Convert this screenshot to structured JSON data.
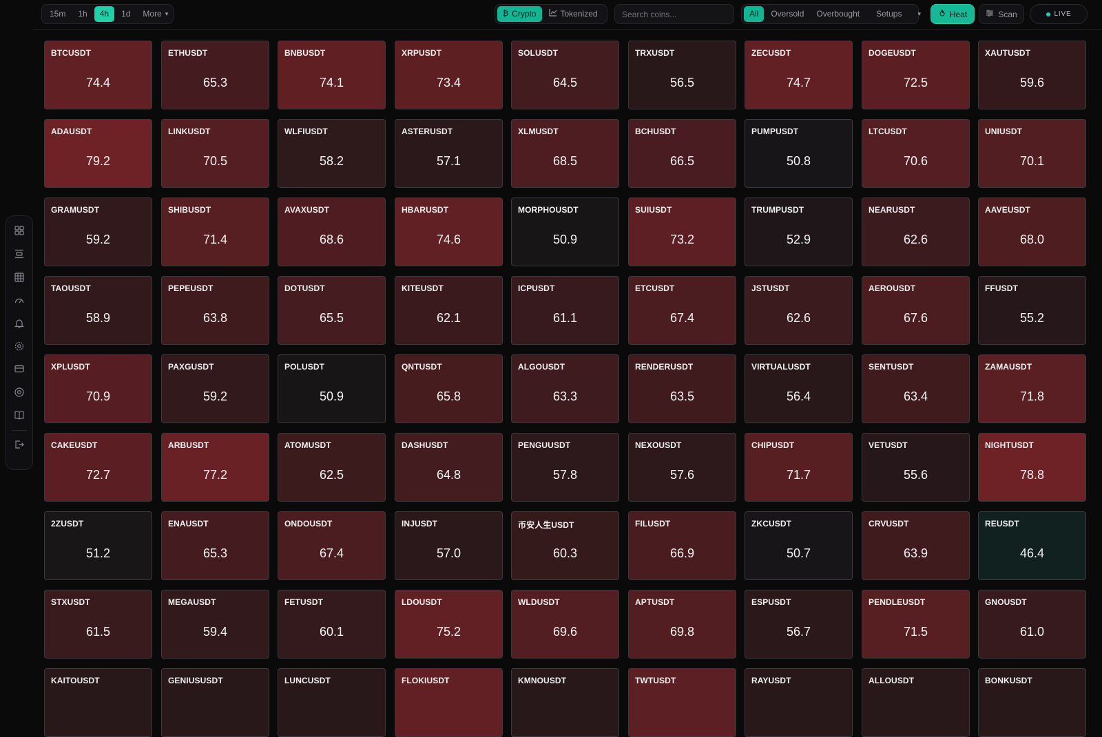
{
  "timeframe": {
    "options": [
      "15m",
      "1h",
      "4h",
      "1d"
    ],
    "selected": "4h",
    "more_label": "More"
  },
  "source": {
    "crypto_label": "Crypto",
    "tokenized_label": "Tokenized"
  },
  "search": {
    "placeholder": "Search coins..."
  },
  "filters": {
    "all_label": "All",
    "oversold_label": "Oversold",
    "overbought_label": "Overbought",
    "setups_label": "Setups"
  },
  "heat_label": "Heat",
  "scan_label": "Scan",
  "live_label": "LIVE",
  "colors": {
    "accent": "#1fd1a8",
    "background": "#0a0a0b",
    "tile_neutral": "#151517",
    "tile_hot": "#6f2226",
    "tile_cool": "#10201e"
  },
  "sidebar": {
    "icons": [
      "dashboard-icon",
      "align-icon",
      "grid-icon",
      "gauge-icon",
      "bell-icon",
      "settings-icon",
      "card-icon",
      "help-icon",
      "book-icon",
      "logout-icon"
    ]
  },
  "tiles": [
    {
      "symbol": "BTCUSDT",
      "value": "74.4"
    },
    {
      "symbol": "ETHUSDT",
      "value": "65.3"
    },
    {
      "symbol": "BNBUSDT",
      "value": "74.1"
    },
    {
      "symbol": "XRPUSDT",
      "value": "73.4"
    },
    {
      "symbol": "SOLUSDT",
      "value": "64.5"
    },
    {
      "symbol": "TRXUSDT",
      "value": "56.5"
    },
    {
      "symbol": "ZECUSDT",
      "value": "74.7"
    },
    {
      "symbol": "DOGEUSDT",
      "value": "72.5"
    },
    {
      "symbol": "XAUTUSDT",
      "value": "59.6"
    },
    {
      "symbol": "ADAUSDT",
      "value": "79.2"
    },
    {
      "symbol": "LINKUSDT",
      "value": "70.5"
    },
    {
      "symbol": "WLFIUSDT",
      "value": "58.2"
    },
    {
      "symbol": "ASTERUSDT",
      "value": "57.1"
    },
    {
      "symbol": "XLMUSDT",
      "value": "68.5"
    },
    {
      "symbol": "BCHUSDT",
      "value": "66.5"
    },
    {
      "symbol": "PUMPUSDT",
      "value": "50.8"
    },
    {
      "symbol": "LTCUSDT",
      "value": "70.6"
    },
    {
      "symbol": "UNIUSDT",
      "value": "70.1"
    },
    {
      "symbol": "GRAMUSDT",
      "value": "59.2"
    },
    {
      "symbol": "SHIBUSDT",
      "value": "71.4"
    },
    {
      "symbol": "AVAXUSDT",
      "value": "68.6"
    },
    {
      "symbol": "HBARUSDT",
      "value": "74.6"
    },
    {
      "symbol": "MORPHOUSDT",
      "value": "50.9"
    },
    {
      "symbol": "SUIUSDT",
      "value": "73.2"
    },
    {
      "symbol": "TRUMPUSDT",
      "value": "52.9"
    },
    {
      "symbol": "NEARUSDT",
      "value": "62.6"
    },
    {
      "symbol": "AAVEUSDT",
      "value": "68.0"
    },
    {
      "symbol": "TAOUSDT",
      "value": "58.9"
    },
    {
      "symbol": "PEPEUSDT",
      "value": "63.8"
    },
    {
      "symbol": "DOTUSDT",
      "value": "65.5"
    },
    {
      "symbol": "KITEUSDT",
      "value": "62.1"
    },
    {
      "symbol": "ICPUSDT",
      "value": "61.1"
    },
    {
      "symbol": "ETCUSDT",
      "value": "67.4"
    },
    {
      "symbol": "JSTUSDT",
      "value": "62.6"
    },
    {
      "symbol": "AEROUSDT",
      "value": "67.6"
    },
    {
      "symbol": "FFUSDT",
      "value": "55.2"
    },
    {
      "symbol": "XPLUSDT",
      "value": "70.9"
    },
    {
      "symbol": "PAXGUSDT",
      "value": "59.2"
    },
    {
      "symbol": "POLUSDT",
      "value": "50.9"
    },
    {
      "symbol": "QNTUSDT",
      "value": "65.8"
    },
    {
      "symbol": "ALGOUSDT",
      "value": "63.3"
    },
    {
      "symbol": "RENDERUSDT",
      "value": "63.5"
    },
    {
      "symbol": "VIRTUALUSDT",
      "value": "56.4"
    },
    {
      "symbol": "SENTUSDT",
      "value": "63.4"
    },
    {
      "symbol": "ZAMAUSDT",
      "value": "71.8"
    },
    {
      "symbol": "CAKEUSDT",
      "value": "72.7"
    },
    {
      "symbol": "ARBUSDT",
      "value": "77.2"
    },
    {
      "symbol": "ATOMUSDT",
      "value": "62.5"
    },
    {
      "symbol": "DASHUSDT",
      "value": "64.8"
    },
    {
      "symbol": "PENGUUSDT",
      "value": "57.8"
    },
    {
      "symbol": "NEXOUSDT",
      "value": "57.6"
    },
    {
      "symbol": "CHIPUSDT",
      "value": "71.7"
    },
    {
      "symbol": "VETUSDT",
      "value": "55.6"
    },
    {
      "symbol": "NIGHTUSDT",
      "value": "78.8"
    },
    {
      "symbol": "2ZUSDT",
      "value": "51.2"
    },
    {
      "symbol": "ENAUSDT",
      "value": "65.3"
    },
    {
      "symbol": "ONDOUSDT",
      "value": "67.4"
    },
    {
      "symbol": "INJUSDT",
      "value": "57.0"
    },
    {
      "symbol": "币安人生USDT",
      "value": "60.3"
    },
    {
      "symbol": "FILUSDT",
      "value": "66.9"
    },
    {
      "symbol": "ZKCUSDT",
      "value": "50.7"
    },
    {
      "symbol": "CRVUSDT",
      "value": "63.9"
    },
    {
      "symbol": "REUSDT",
      "value": "46.4"
    },
    {
      "symbol": "STXUSDT",
      "value": "61.5"
    },
    {
      "symbol": "MEGAUSDT",
      "value": "59.4"
    },
    {
      "symbol": "FETUSDT",
      "value": "60.1"
    },
    {
      "symbol": "LDOUSDT",
      "value": "75.2"
    },
    {
      "symbol": "WLDUSDT",
      "value": "69.6"
    },
    {
      "symbol": "APTUSDT",
      "value": "69.8"
    },
    {
      "symbol": "ESPUSDT",
      "value": "56.7"
    },
    {
      "symbol": "PENDLEUSDT",
      "value": "71.5"
    },
    {
      "symbol": "GNOUSDT",
      "value": "61.0"
    },
    {
      "symbol": "KAITOUSDT",
      "value": ""
    },
    {
      "symbol": "GENIUSUSDT",
      "value": ""
    },
    {
      "symbol": "LUNCUSDT",
      "value": ""
    },
    {
      "symbol": "FLOKIUSDT",
      "value": "",
      "level": "75"
    },
    {
      "symbol": "KMNOUSDT",
      "value": ""
    },
    {
      "symbol": "TWTUSDT",
      "value": "",
      "level": "73"
    },
    {
      "symbol": "RAYUSDT",
      "value": "",
      "level": "56"
    },
    {
      "symbol": "ALLOUSDT",
      "value": "",
      "level": "56"
    },
    {
      "symbol": "BONKUSDT",
      "value": "",
      "level": "56"
    }
  ]
}
